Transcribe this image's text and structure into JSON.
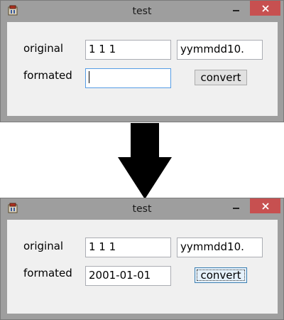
{
  "windows": [
    {
      "title": "test",
      "original_label": "original",
      "original_value": "1 1 1",
      "format_value": "yymmdd10.",
      "formated_label": "formated",
      "formated_value": "",
      "convert_label": "convert"
    },
    {
      "title": "test",
      "original_label": "original",
      "original_value": "1 1 1",
      "format_value": "yymmdd10.",
      "formated_label": "formated",
      "formated_value": "2001-01-01",
      "convert_label": "convert"
    }
  ],
  "arrow": {
    "icon": "down-arrow-icon",
    "color": "#000000"
  },
  "colors": {
    "close_button": "#c75050",
    "window_frame": "#9e9e9e",
    "client_area": "#f0f0f0",
    "focus_border": "#569de5"
  }
}
